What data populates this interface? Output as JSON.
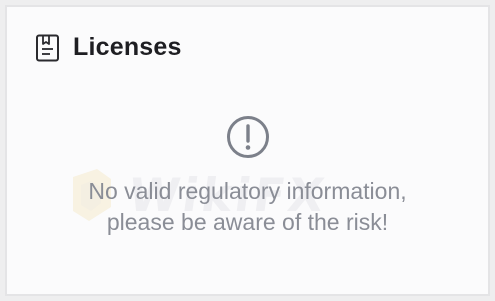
{
  "section": {
    "title": "Licenses",
    "icon": "license-document-icon"
  },
  "empty_state": {
    "icon": "exclamation-circle-icon",
    "line1": "No valid regulatory information,",
    "line2": "please be aware of the risk!"
  },
  "watermark": {
    "text": "WikiFX",
    "icon": "wikifx-logo-mark"
  },
  "colors": {
    "title": "#1e1e22",
    "message": "#8a8d96",
    "icon_stroke": "#7c808a",
    "card_bg": "#fbfbfc",
    "frame_bg": "#eeeeef"
  }
}
